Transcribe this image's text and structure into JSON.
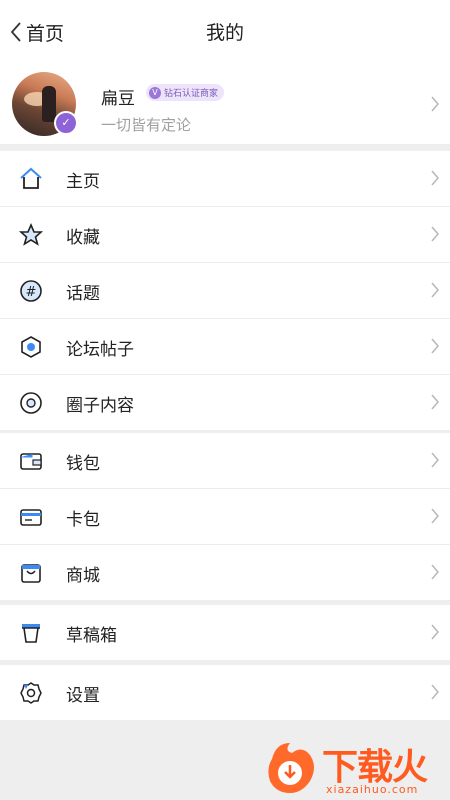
{
  "header": {
    "back_label": "首页",
    "title": "我的"
  },
  "profile": {
    "nickname": "扁豆",
    "badge_text": "钻石认证商家",
    "signature": "一切皆有定论"
  },
  "menu_groups": [
    {
      "items": [
        {
          "label": "主页",
          "icon": "home-icon"
        },
        {
          "label": "收藏",
          "icon": "star-icon"
        },
        {
          "label": "话题",
          "icon": "hashtag-icon"
        },
        {
          "label": "论坛帖子",
          "icon": "hexagon-icon"
        },
        {
          "label": "圈子内容",
          "icon": "circle-target-icon"
        }
      ]
    },
    {
      "items": [
        {
          "label": "钱包",
          "icon": "wallet-icon"
        },
        {
          "label": "卡包",
          "icon": "card-icon"
        },
        {
          "label": "商城",
          "icon": "shop-bag-icon"
        }
      ]
    },
    {
      "items": [
        {
          "label": "草稿箱",
          "icon": "draft-cup-icon"
        }
      ]
    },
    {
      "items": [
        {
          "label": "设置",
          "icon": "gear-icon"
        }
      ]
    }
  ],
  "watermark": {
    "brand": "下载火",
    "domain": "xiazaihuo.com"
  },
  "colors": {
    "accent_blue": "#3d8bf2",
    "badge_purple": "#8e63d8",
    "brand_orange": "#ff5a1f"
  }
}
